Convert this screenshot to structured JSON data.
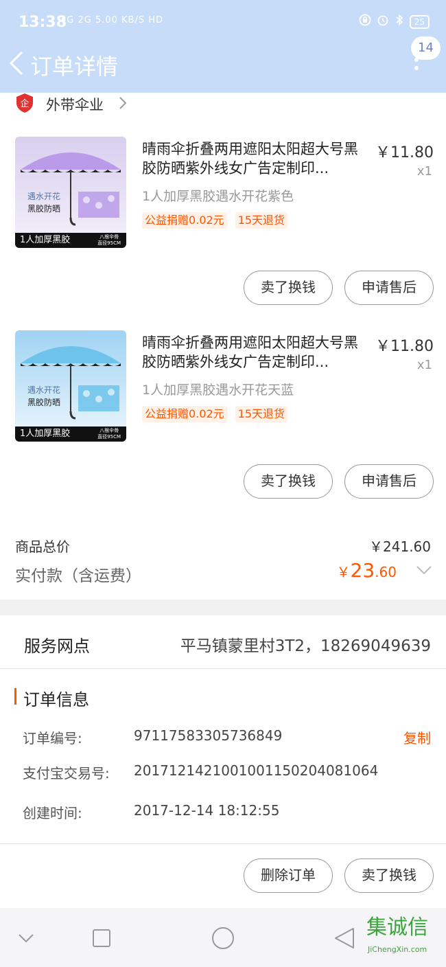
{
  "status_bar": {
    "time": "13:38",
    "network": "4G 2G 5.00 KB/S HD",
    "battery": "25"
  },
  "nav": {
    "title": "订单详情",
    "badge_count": "14"
  },
  "shop": {
    "icon_label": "企",
    "name": "外带伞业"
  },
  "items": [
    {
      "title": "晴雨伞折叠两用遮阳太阳超大号黑胶防晒紫外线女广告定制印...",
      "price": "￥11.80",
      "qty": "x1",
      "sku": "1人加厚黑胶遇水开花紫色",
      "tags": [
        "公益捐赠0.02元",
        "15天退货"
      ],
      "thumb_line1": "遇水开花",
      "thumb_line2": "黑胶防晒",
      "thumb_bottom": "1人加厚黑胶",
      "thumb_small1": "八根伞骨",
      "thumb_small2": "直径95CM",
      "color": "#b99be9",
      "btn_sell": "卖了换钱",
      "btn_after": "申请售后"
    },
    {
      "title": "晴雨伞折叠两用遮阳太阳超大号黑胶防晒紫外线女广告定制印...",
      "price": "￥11.80",
      "qty": "x1",
      "sku": "1人加厚黑胶遇水开花天蓝",
      "tags": [
        "公益捐赠0.02元",
        "15天退货"
      ],
      "thumb_line1": "遇水开花",
      "thumb_line2": "黑胶防晒",
      "thumb_bottom": "1人加厚黑胶",
      "thumb_small1": "八根伞骨",
      "thumb_small2": "直径95CM",
      "color": "#6ec3ec",
      "btn_sell": "卖了换钱",
      "btn_after": "申请售后"
    }
  ],
  "totals": {
    "goods_total_label": "商品总价",
    "goods_total_value": "￥241.60",
    "paid_label": "实付款（含运费）",
    "paid_currency": "￥",
    "paid_int": "23",
    "paid_dec": ".60"
  },
  "service": {
    "label": "服务网点",
    "value": "平马镇蒙里村3T2，18269049639"
  },
  "order_info": {
    "title": "订单信息",
    "order_no_label": "订单编号:",
    "order_no": "97117583305736849",
    "copy_label": "复制",
    "alipay_label": "支付宝交易号:",
    "alipay_no": "2017121421001001150204081064",
    "created_label": "创建时间:",
    "created": "2017-12-14 18:12:55"
  },
  "actions": {
    "delete_order": "删除订单",
    "sell": "卖了换钱"
  },
  "watermark": {
    "logo": "集诚信",
    "url": "JiChengXin.com"
  },
  "colors": {
    "header": "#c7dcf8",
    "accent": "#ff5500"
  }
}
